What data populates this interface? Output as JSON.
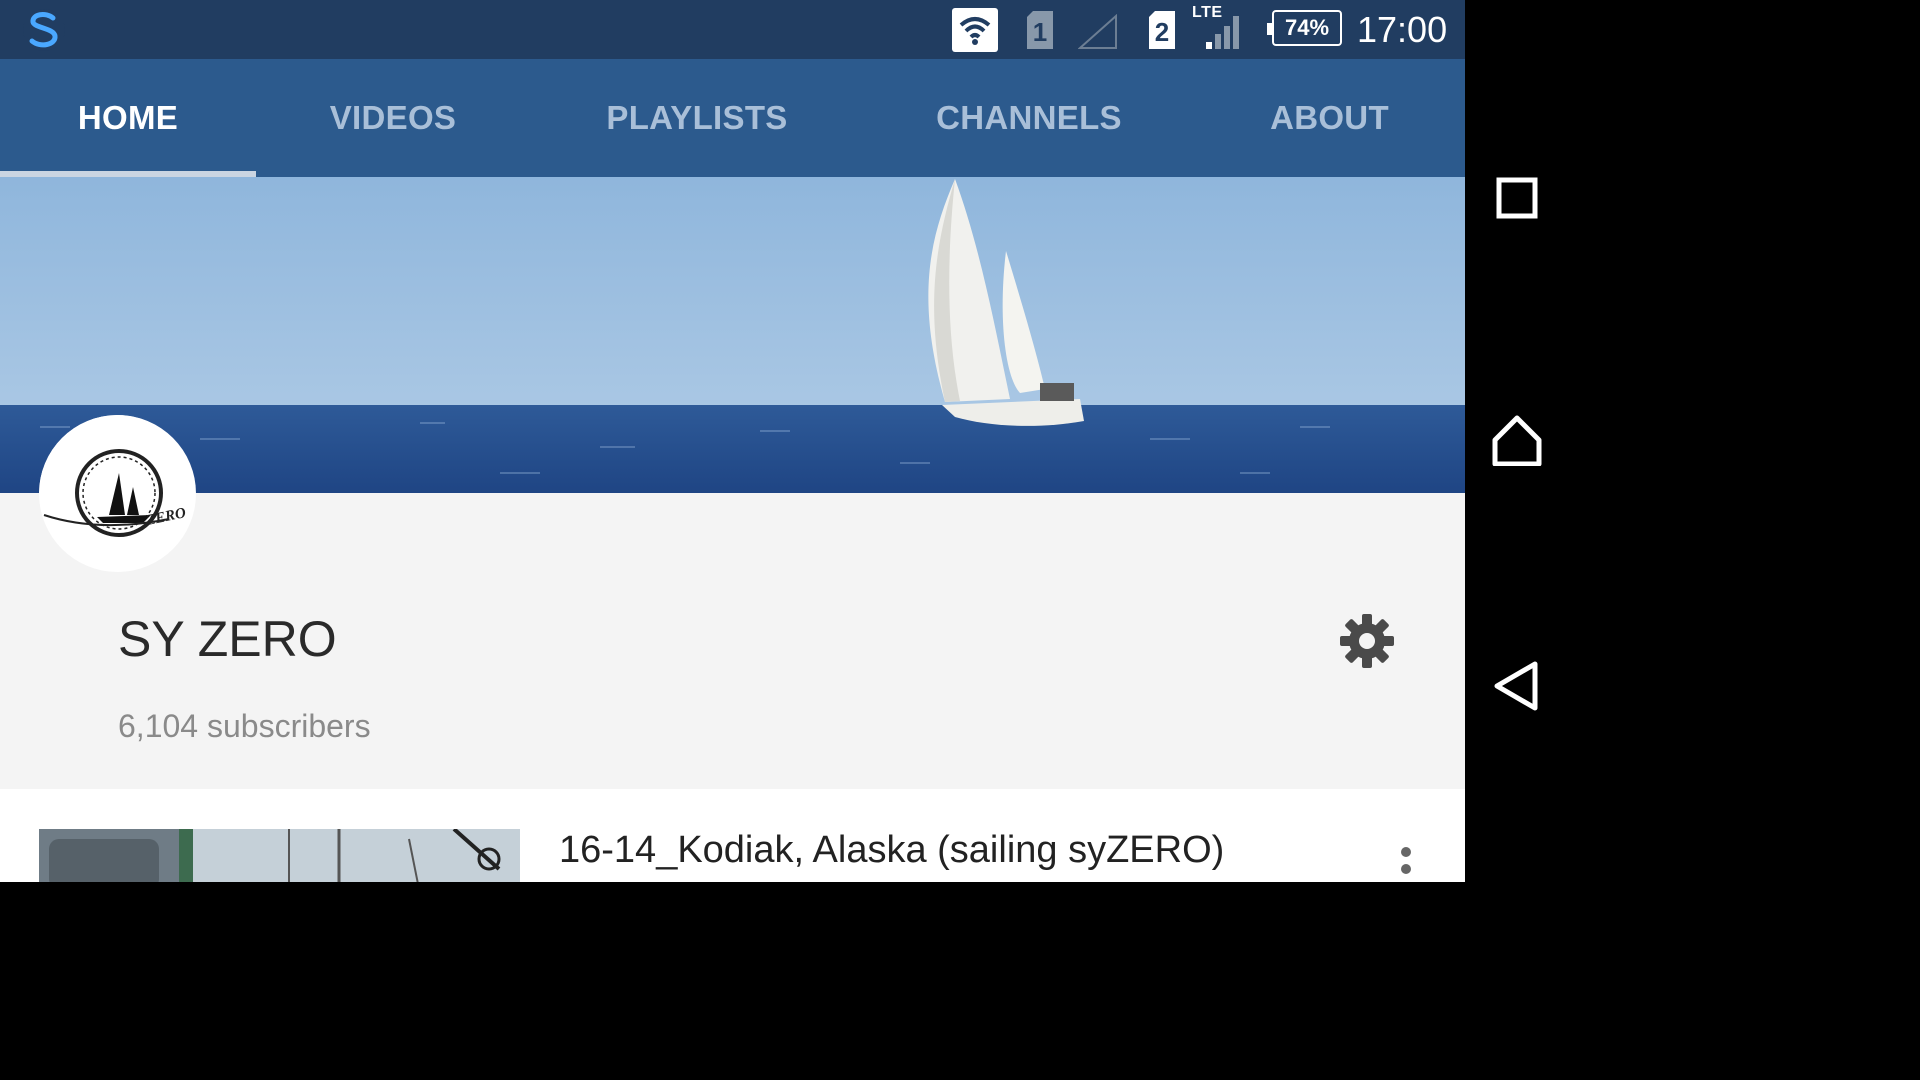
{
  "status_bar": {
    "sim1_label": "1",
    "sim2_label": "2",
    "network_type": "LTE",
    "battery": "74%",
    "time": "17:00",
    "icons": [
      "app-s-icon",
      "wifi-icon",
      "sim1-icon",
      "signal-empty-icon",
      "sim2-icon",
      "signal-icon",
      "battery-icon"
    ]
  },
  "tabs": [
    {
      "label": "HOME",
      "active": true
    },
    {
      "label": "VIDEOS",
      "active": false
    },
    {
      "label": "PLAYLISTS",
      "active": false
    },
    {
      "label": "CHANNELS",
      "active": false
    },
    {
      "label": "ABOUT",
      "active": false
    }
  ],
  "channel": {
    "name": "SY ZERO",
    "subscribers": "6,104 subscribers",
    "avatar_text": "ZERO"
  },
  "videos": [
    {
      "title": "16-14_Kodiak, Alaska (sailing syZERO)"
    }
  ],
  "colors": {
    "status_bar": "#213d61",
    "tab_bar": "#2c5a8d",
    "page_bg": "#f4f4f4",
    "nav_bar": "#000000"
  }
}
